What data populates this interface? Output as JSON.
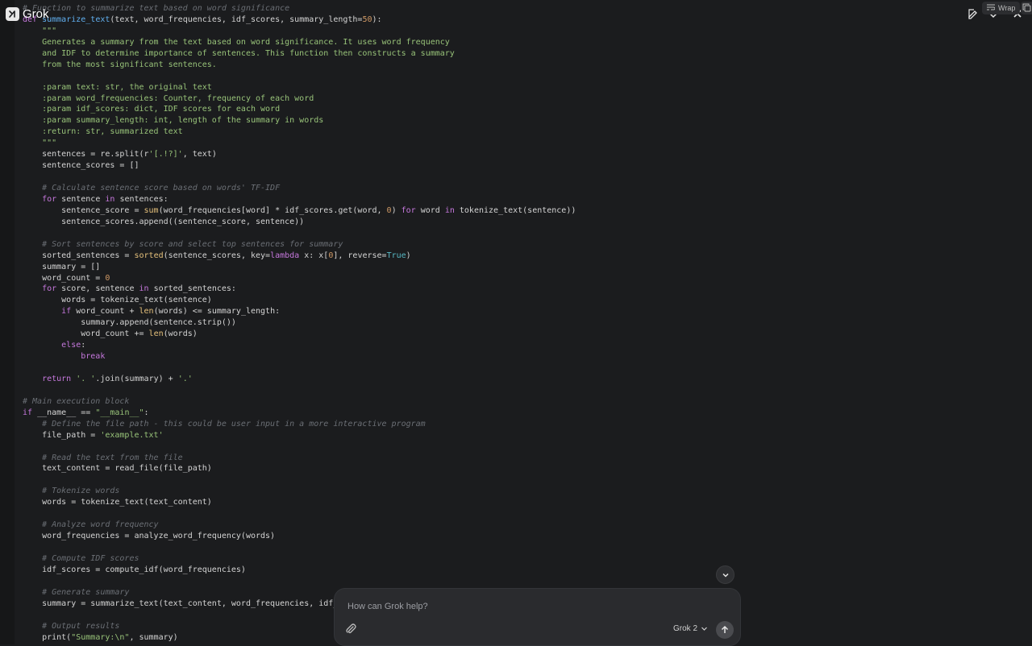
{
  "app": {
    "name": "Grok"
  },
  "toolbar": {
    "wrap_label": "Wrap"
  },
  "composer": {
    "placeholder": "How can Grok help?",
    "model_label": "Grok 2"
  },
  "code_lines": [
    [
      [
        "cmt",
        "# Function to summarize text based on word significance"
      ]
    ],
    [
      [
        "def",
        "def "
      ],
      [
        "fn",
        "summarize_text"
      ],
      [
        "plain",
        "(text, word_frequencies, idf_scores, summary_length="
      ],
      [
        "num",
        "50"
      ],
      [
        "plain",
        "):"
      ]
    ],
    [
      [
        "doc",
        "    \"\"\""
      ]
    ],
    [
      [
        "doc",
        "    Generates a summary from the text based on word significance. It uses word frequency"
      ]
    ],
    [
      [
        "doc",
        "    and IDF to determine importance of sentences. This function then constructs a summary"
      ]
    ],
    [
      [
        "doc",
        "    from the most significant sentences."
      ]
    ],
    [
      [
        "doc",
        ""
      ]
    ],
    [
      [
        "doc",
        "    :param text: str, the original text"
      ]
    ],
    [
      [
        "doc",
        "    :param word_frequencies: Counter, frequency of each word"
      ]
    ],
    [
      [
        "doc",
        "    :param idf_scores: dict, IDF scores for each word"
      ]
    ],
    [
      [
        "doc",
        "    :param summary_length: int, length of the summary in words"
      ]
    ],
    [
      [
        "doc",
        "    :return: str, summarized text"
      ]
    ],
    [
      [
        "doc",
        "    \"\"\""
      ]
    ],
    [
      [
        "plain",
        "    sentences = re.split(r"
      ],
      [
        "str",
        "'[.!?]'"
      ],
      [
        "plain",
        ", text)"
      ]
    ],
    [
      [
        "plain",
        "    sentence_scores = []"
      ]
    ],
    [
      [
        "plain",
        ""
      ]
    ],
    [
      [
        "cmt",
        "    # Calculate sentence score based on words' TF-IDF"
      ]
    ],
    [
      [
        "kw",
        "    for"
      ],
      [
        "plain",
        " sentence "
      ],
      [
        "kw",
        "in"
      ],
      [
        "plain",
        " sentences:"
      ]
    ],
    [
      [
        "plain",
        "        sentence_score = "
      ],
      [
        "bi",
        "sum"
      ],
      [
        "plain",
        "(word_frequencies[word] * idf_scores.get(word, "
      ],
      [
        "num",
        "0"
      ],
      [
        "plain",
        ") "
      ],
      [
        "kw",
        "for"
      ],
      [
        "plain",
        " word "
      ],
      [
        "kw",
        "in"
      ],
      [
        "plain",
        " tokenize_text(sentence))"
      ]
    ],
    [
      [
        "plain",
        "        sentence_scores.append((sentence_score, sentence))"
      ]
    ],
    [
      [
        "plain",
        ""
      ]
    ],
    [
      [
        "cmt",
        "    # Sort sentences by score and select top sentences for summary"
      ]
    ],
    [
      [
        "plain",
        "    sorted_sentences = "
      ],
      [
        "bi",
        "sorted"
      ],
      [
        "plain",
        "(sentence_scores, key="
      ],
      [
        "kw",
        "lambda"
      ],
      [
        "plain",
        " x: x["
      ],
      [
        "num",
        "0"
      ],
      [
        "plain",
        "], reverse="
      ],
      [
        "const",
        "True"
      ],
      [
        "plain",
        ")"
      ]
    ],
    [
      [
        "plain",
        "    summary = []"
      ]
    ],
    [
      [
        "plain",
        "    word_count = "
      ],
      [
        "num",
        "0"
      ]
    ],
    [
      [
        "kw",
        "    for"
      ],
      [
        "plain",
        " score, sentence "
      ],
      [
        "kw",
        "in"
      ],
      [
        "plain",
        " sorted_sentences:"
      ]
    ],
    [
      [
        "plain",
        "        words = tokenize_text(sentence)"
      ]
    ],
    [
      [
        "kw",
        "        if"
      ],
      [
        "plain",
        " word_count + "
      ],
      [
        "bi",
        "len"
      ],
      [
        "plain",
        "(words) <= summary_length:"
      ]
    ],
    [
      [
        "plain",
        "            summary.append(sentence.strip())"
      ]
    ],
    [
      [
        "plain",
        "            word_count += "
      ],
      [
        "bi",
        "len"
      ],
      [
        "plain",
        "(words)"
      ]
    ],
    [
      [
        "kw",
        "        else"
      ],
      [
        "plain",
        ":"
      ]
    ],
    [
      [
        "kw",
        "            break"
      ]
    ],
    [
      [
        "plain",
        ""
      ]
    ],
    [
      [
        "kw",
        "    return"
      ],
      [
        "plain",
        " "
      ],
      [
        "str",
        "'. '"
      ],
      [
        "plain",
        ".join(summary) + "
      ],
      [
        "str",
        "'.'"
      ]
    ],
    [
      [
        "plain",
        ""
      ]
    ],
    [
      [
        "cmt",
        "# Main execution block"
      ]
    ],
    [
      [
        "kw",
        "if"
      ],
      [
        "plain",
        " __name__ == "
      ],
      [
        "str",
        "\"__main__\""
      ],
      [
        "plain",
        ":"
      ]
    ],
    [
      [
        "cmt",
        "    # Define the file path - this could be user input in a more interactive program"
      ]
    ],
    [
      [
        "plain",
        "    file_path = "
      ],
      [
        "str",
        "'example.txt'"
      ]
    ],
    [
      [
        "plain",
        ""
      ]
    ],
    [
      [
        "cmt",
        "    # Read the text from the file"
      ]
    ],
    [
      [
        "plain",
        "    text_content = read_file(file_path)"
      ]
    ],
    [
      [
        "plain",
        ""
      ]
    ],
    [
      [
        "cmt",
        "    # Tokenize words"
      ]
    ],
    [
      [
        "plain",
        "    words = tokenize_text(text_content)"
      ]
    ],
    [
      [
        "plain",
        ""
      ]
    ],
    [
      [
        "cmt",
        "    # Analyze word frequency"
      ]
    ],
    [
      [
        "plain",
        "    word_frequencies = analyze_word_frequency(words)"
      ]
    ],
    [
      [
        "plain",
        ""
      ]
    ],
    [
      [
        "cmt",
        "    # Compute IDF scores"
      ]
    ],
    [
      [
        "plain",
        "    idf_scores = compute_idf(word_frequencies)"
      ]
    ],
    [
      [
        "plain",
        ""
      ]
    ],
    [
      [
        "cmt",
        "    # Generate summary"
      ]
    ],
    [
      [
        "plain",
        "    summary = summarize_text(text_content, word_frequencies, idf_scores)"
      ]
    ],
    [
      [
        "plain",
        ""
      ]
    ],
    [
      [
        "cmt",
        "    # Output results"
      ]
    ],
    [
      [
        "plain",
        "    print("
      ],
      [
        "str",
        "\"Summary:\\n\""
      ],
      [
        "plain",
        ", summary)"
      ]
    ]
  ]
}
